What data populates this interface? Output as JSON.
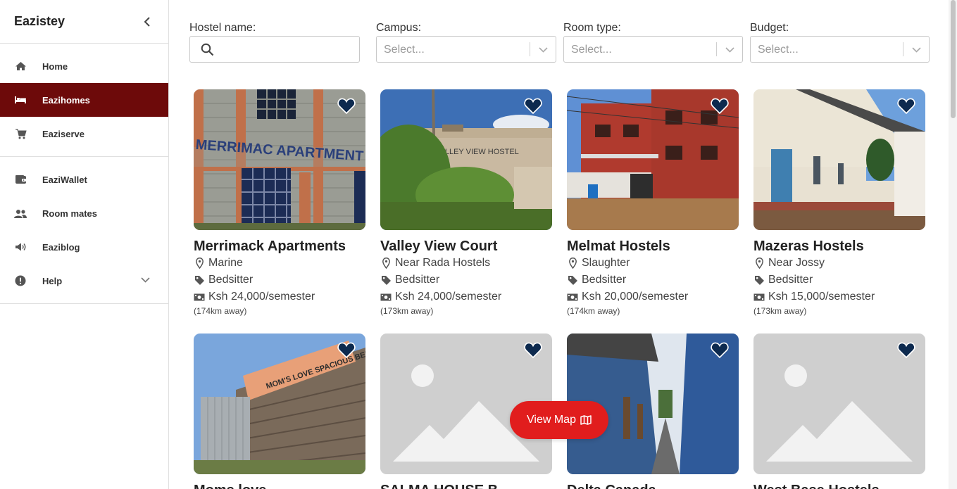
{
  "app": {
    "title": "Eazistey"
  },
  "sidebar": {
    "items": [
      {
        "label": "Home",
        "icon": "home-icon"
      },
      {
        "label": "Eazihomes",
        "icon": "bed-icon",
        "active": true
      },
      {
        "label": "Eaziserve",
        "icon": "cart-icon"
      },
      {
        "label": "EaziWallet",
        "icon": "wallet-icon"
      },
      {
        "label": "Room mates",
        "icon": "people-icon"
      },
      {
        "label": "Eaziblog",
        "icon": "megaphone-icon"
      },
      {
        "label": "Help",
        "icon": "alert-icon"
      }
    ]
  },
  "filters": {
    "hostel_name": {
      "label": "Hostel name:",
      "placeholder": ""
    },
    "campus": {
      "label": "Campus:",
      "placeholder": "Select..."
    },
    "room_type": {
      "label": "Room type:",
      "placeholder": "Select..."
    },
    "budget": {
      "label": "Budget:",
      "placeholder": "Select..."
    }
  },
  "listings": [
    {
      "name": "Merrimack Apartments",
      "location": "Marine",
      "room_type": "Bedsitter",
      "price": "Ksh 24,000/semester",
      "distance": "(174km away)"
    },
    {
      "name": "Valley View Court",
      "location": "Near Rada Hostels",
      "room_type": "Bedsitter",
      "price": "Ksh 24,000/semester",
      "distance": "(173km away)"
    },
    {
      "name": "Melmat Hostels",
      "location": "Slaughter",
      "room_type": "Bedsitter",
      "price": "Ksh 20,000/semester",
      "distance": "(174km away)"
    },
    {
      "name": "Mazeras Hostels",
      "location": "Near Jossy",
      "room_type": "Bedsitter",
      "price": "Ksh 15,000/semester",
      "distance": "(173km away)"
    },
    {
      "name": "Moms love"
    },
    {
      "name": "SALMA HOUSE B"
    },
    {
      "name": "Delta Canada"
    },
    {
      "name": "West Base Hostels"
    }
  ],
  "view_map": {
    "label": "View Map"
  },
  "colors": {
    "accent": "#6d0a0a",
    "button": "#e11d1d",
    "heart": "#0d2a4f"
  }
}
